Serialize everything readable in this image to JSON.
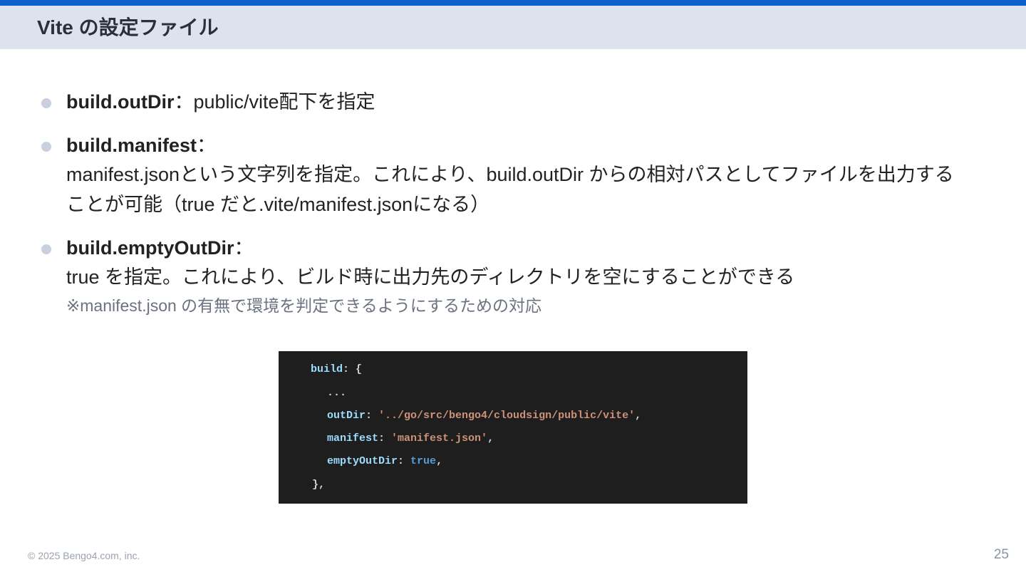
{
  "slide": {
    "title": "Vite の設定ファイル",
    "accent_color": "#0b61c9",
    "header_bg": "#dce3ee"
  },
  "bullets": [
    {
      "term": "build.outDir",
      "separator": "：",
      "text": "public/vite配下を指定"
    },
    {
      "term": "build.manifest",
      "separator": "：",
      "lines": [
        "manifest.jsonという文字列を指定。これにより、build.outDir からの相対パスとしてファイルを出力する",
        "ことが可能（true だと.vite/manifest.jsonになる）"
      ]
    },
    {
      "term": "build.emptyOutDir",
      "separator": "：",
      "lines": [
        "true を指定。これにより、ビルド時に出力先のディレクトリを空にすることができる"
      ],
      "note": "※manifest.json の有無で環境を判定できるようにするための対応"
    }
  ],
  "code": {
    "l1_key": "build",
    "l1_rest": ": {",
    "l2": "...",
    "l3_key": "outDir",
    "l3_colon": ": ",
    "l3_value": "'../go/src/bengo4/cloudsign/public/vite'",
    "l3_comma": ",",
    "l4_key": "manifest",
    "l4_colon": ": ",
    "l4_value": "'manifest.json'",
    "l4_comma": ",",
    "l5_key": "emptyOutDir",
    "l5_colon": ": ",
    "l5_value": "true",
    "l5_comma": ",",
    "l6": "},"
  },
  "footer": {
    "copyright": "© 2025 Bengo4.com, inc.",
    "page_number": "25"
  }
}
